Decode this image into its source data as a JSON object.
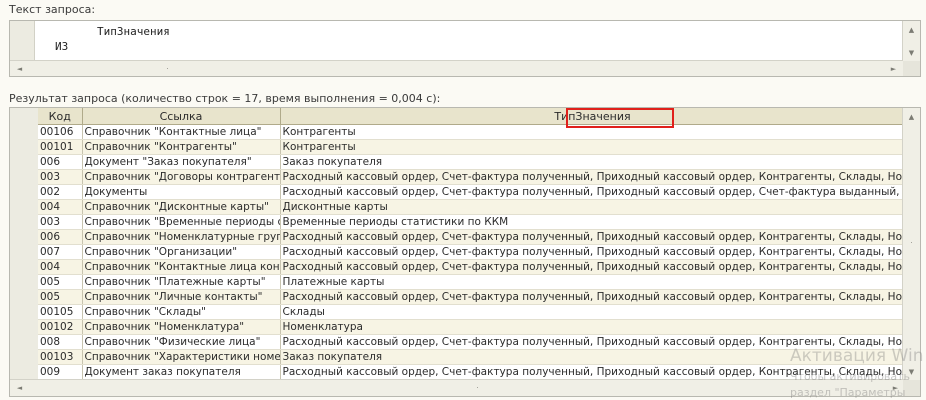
{
  "query_section": {
    "label": "Текст запроса:",
    "lines": [
      "ТипЗначения",
      "ИЗ"
    ]
  },
  "result_section": {
    "label": "Результат запроса (количество строк = 17, время выполнения = 0,004 с):",
    "columns": [
      "Код",
      "Ссылка",
      "ТипЗначения"
    ],
    "rows": [
      [
        "00106",
        "Справочник \"Контактные лица\"",
        "Контрагенты"
      ],
      [
        "00101",
        "Справочник \"Контрагенты\"",
        "Контрагенты"
      ],
      [
        "006",
        "Документ \"Заказ покупателя\"",
        "Заказ покупателя"
      ],
      [
        "003",
        "Справочник \"Договоры контрагентов\"",
        "Расходный кассовый ордер, Счет-фактура полученный, Приходный кассовый ордер, Контрагенты, Склады, Номенклатура"
      ],
      [
        "002",
        "Документы",
        "Расходный кассовый ордер, Счет-фактура полученный, Приходный кассовый ордер, Счет-фактура выданный, Заказ поставщику"
      ],
      [
        "004",
        "Справочник \"Дисконтные карты\"",
        "Дисконтные карты"
      ],
      [
        "003",
        "Справочник \"Временные периоды статистики\"",
        "Временные периоды статистики по ККМ"
      ],
      [
        "006",
        "Справочник \"Номенклатурные группы\"",
        "Расходный кассовый ордер, Счет-фактура полученный, Приходный кассовый ордер, Контрагенты, Склады, Номенклатура"
      ],
      [
        "007",
        "Справочник \"Организации\"",
        "Расходный кассовый ордер, Счет-фактура полученный, Приходный кассовый ордер, Контрагенты, Склады, Номенклатура"
      ],
      [
        "004",
        "Справочник \"Контактные лица контрагентов\"",
        "Расходный кассовый ордер, Счет-фактура полученный, Приходный кассовый ордер, Контрагенты, Склады, Номенклатура"
      ],
      [
        "005",
        "Справочник \"Платежные карты\"",
        "Платежные карты"
      ],
      [
        "005",
        "Справочник \"Личные контакты\"",
        "Расходный кассовый ордер, Счет-фактура полученный, Приходный кассовый ордер, Контрагенты, Склады, Номенклатура"
      ],
      [
        "00105",
        "Справочник \"Склады\"",
        "Склады"
      ],
      [
        "00102",
        "Справочник \"Номенклатура\"",
        "Номенклатура"
      ],
      [
        "008",
        "Справочник \"Физические лица\"",
        "Расходный кассовый ордер, Счет-фактура полученный, Приходный кассовый ордер, Контрагенты, Склады, Номенклатура"
      ],
      [
        "00103",
        "Справочник \"Характеристики номенклатуры\"",
        "Заказ покупателя"
      ],
      [
        "009",
        "Документ заказ покупателя",
        "Расходный кассовый ордер, Счет-фактура полученный, Приходный кассовый ордер, Контрагенты, Склады, Номенклатура"
      ]
    ]
  },
  "watermark": {
    "line1": "Активация Win",
    "line2": "Чтобы активировать",
    "line3": "раздел \"Параметры"
  },
  "icons": {
    "scroll_up": "▲",
    "scroll_down": "▼",
    "scroll_left": "◄",
    "scroll_right": "►",
    "grip": "·"
  },
  "colors": {
    "highlight": "#e0201b",
    "header_bg": "#e8e4cc",
    "stripe": "#f7f4e4"
  }
}
